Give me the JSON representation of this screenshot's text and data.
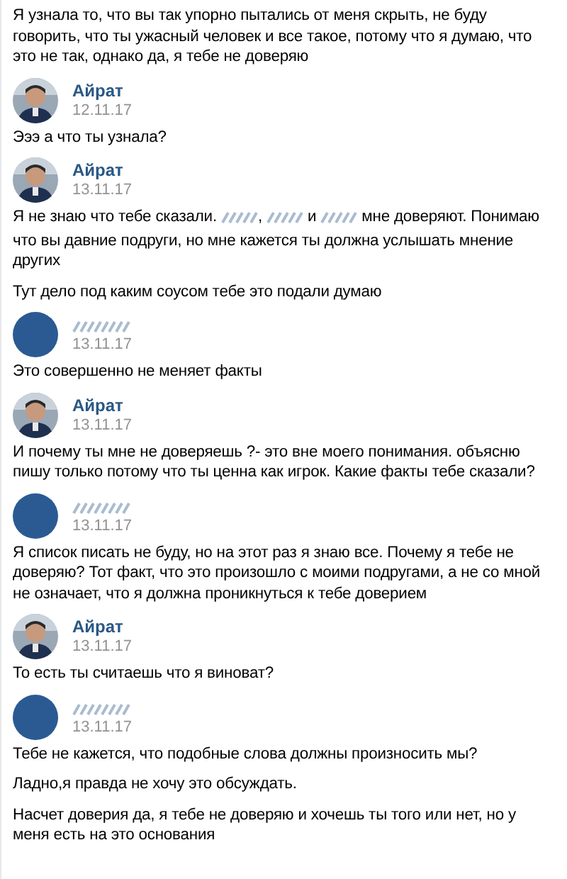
{
  "blocks": [
    {
      "messages": [
        {
          "parts": [
            {
              "kind": "text",
              "text": "Я узнала то, что вы так упорно пытались от меня скрыть, не буду говорить, что ты ужасный человек и все такое, потому что я думаю, что это не так, однако да, я тебе не доверяю"
            }
          ]
        }
      ]
    },
    {
      "author": {
        "name": "Айрат",
        "date": "12.11.17"
      },
      "messages": [
        {
          "parts": [
            {
              "kind": "text",
              "text": "Эээ а что ты узнала?"
            }
          ]
        }
      ]
    },
    {
      "author": {
        "name": "Айрат",
        "date": "13.11.17"
      },
      "messages": [
        {
          "parts": [
            {
              "kind": "text",
              "text": "Я не знаю что тебе сказали. "
            },
            {
              "kind": "redacted"
            },
            {
              "kind": "text",
              "text": ", "
            },
            {
              "kind": "redacted"
            },
            {
              "kind": "text",
              "text": " и "
            },
            {
              "kind": "redacted"
            },
            {
              "kind": "text",
              "text": " мне доверяют. Понимаю что вы давние подруги, но мне кажется ты должна услышать мнение других"
            }
          ]
        },
        {
          "parts": [
            {
              "kind": "text",
              "text": "Тут дело под каким соусом тебе это подали думаю"
            }
          ]
        }
      ]
    },
    {
      "author": {
        "kind": "plain",
        "date": "13.11.17"
      },
      "messages": [
        {
          "parts": [
            {
              "kind": "text",
              "text": "Это совершенно не меняет факты"
            }
          ]
        }
      ]
    },
    {
      "author": {
        "name": "Айрат",
        "date": "13.11.17"
      },
      "messages": [
        {
          "parts": [
            {
              "kind": "text",
              "text": "И почему ты мне не доверяешь ?- это вне моего понимания. объясню пишу только потому что ты ценна как игрок. Какие факты тебе сказали?"
            }
          ]
        }
      ]
    },
    {
      "author": {
        "kind": "plain",
        "date": "13.11.17"
      },
      "messages": [
        {
          "parts": [
            {
              "kind": "text",
              "text": "Я список писать не буду, но на этот раз я знаю все. Почему я тебе не доверяю? Тот факт, что это произошло с моими подругами, а не со мной не означает, что я должна проникнуться к тебе доверием"
            }
          ]
        }
      ]
    },
    {
      "author": {
        "name": "Айрат",
        "date": "13.11.17"
      },
      "messages": [
        {
          "parts": [
            {
              "kind": "text",
              "text": "То есть ты считаешь что я виноват?"
            }
          ]
        }
      ]
    },
    {
      "author": {
        "kind": "plain",
        "date": "13.11.17"
      },
      "messages": [
        {
          "parts": [
            {
              "kind": "text",
              "text": "Тебе не кажется, что подобные слова должны произносить мы?"
            }
          ]
        },
        {
          "parts": [
            {
              "kind": "text",
              "text": "Ладно,я правда не хочу это обсуждать."
            }
          ]
        },
        {
          "parts": [
            {
              "kind": "text",
              "text": "Насчет доверия да, я тебе не доверяю и хочешь ты того или нет, но у меня есть на это основания"
            }
          ]
        }
      ]
    }
  ]
}
